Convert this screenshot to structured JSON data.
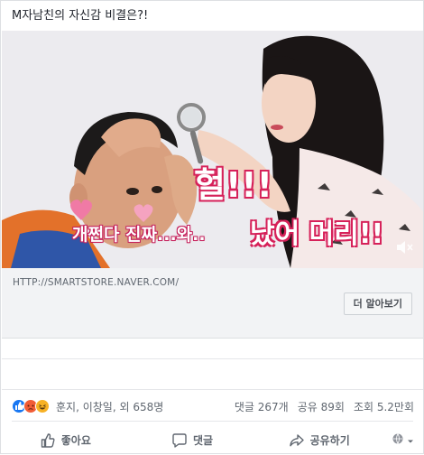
{
  "post": {
    "text": "M자남친의 자신감 비결은?!"
  },
  "video": {
    "captions": {
      "exclaim": "헐!!!",
      "main": "개쩐다 진짜...와..",
      "hair": "났어 머리!!"
    },
    "mute_icon": "speaker-mute-icon"
  },
  "link": {
    "url": "HTTP://SMARTSTORE.NAVER.COM/",
    "button_label": "더 알아보기"
  },
  "stats": {
    "reactions": [
      "like-icon",
      "angry-icon",
      "haha-icon"
    ],
    "names": "훈지, 이창일, 외 658명",
    "comments": "댓글 267개",
    "shares": "공유 89회",
    "views": "조회 5.2만회"
  },
  "actions": {
    "like": "좋아요",
    "comment": "댓글",
    "share": "공유하기"
  },
  "colors": {
    "facebook_blue": "#1877f2",
    "caption_pink": "#d6225a",
    "divider": "#e5e6e9"
  }
}
